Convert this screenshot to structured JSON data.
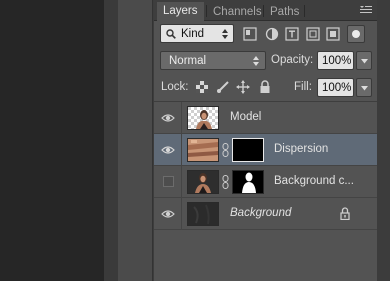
{
  "tabs": [
    {
      "label": "Layers",
      "active": true
    },
    {
      "label": "Channels",
      "active": false
    },
    {
      "label": "Paths",
      "active": false
    }
  ],
  "filter": {
    "value": "Kind"
  },
  "blend": {
    "mode": "Normal",
    "opacity_label": "Opacity:",
    "opacity": "100%"
  },
  "lock": {
    "label": "Lock:",
    "fill_label": "Fill:",
    "fill": "100%"
  },
  "layers": [
    {
      "name": "Model",
      "visible": true,
      "selected": false,
      "italic": false,
      "has_mask": false,
      "locked": false
    },
    {
      "name": "Dispersion",
      "visible": true,
      "selected": true,
      "italic": false,
      "has_mask": true,
      "locked": false
    },
    {
      "name": "Background c...",
      "visible": false,
      "selected": false,
      "italic": false,
      "has_mask": true,
      "locked": false
    },
    {
      "name": "Background",
      "visible": true,
      "selected": false,
      "italic": true,
      "has_mask": false,
      "locked": true
    }
  ],
  "colors": {
    "selected_row": "#5f6a77",
    "panel": "#535353",
    "tabbar": "#3e3e3e"
  }
}
